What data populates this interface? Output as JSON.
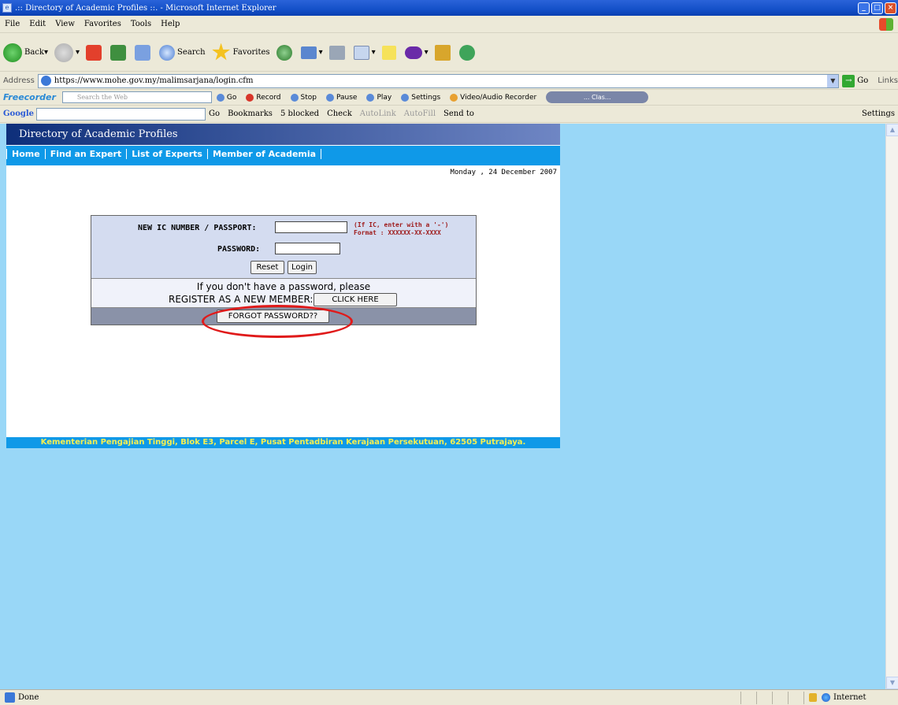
{
  "window": {
    "title": ".:: Directory of Academic Profiles ::. - Microsoft Internet Explorer"
  },
  "menu": [
    "File",
    "Edit",
    "View",
    "Favorites",
    "Tools",
    "Help"
  ],
  "toolbar": {
    "back": "Back",
    "search": "Search",
    "favorites": "Favorites"
  },
  "address": {
    "label": "Address",
    "url": "https://www.mohe.gov.my/malimsarjana/login.cfm",
    "go": "Go",
    "links": "Links"
  },
  "freecorder": {
    "brand": "Freecorder",
    "search_placeholder": "Search the Web",
    "go": "Go",
    "record": "Record",
    "stop": "Stop",
    "pause": "Pause",
    "play": "Play",
    "settings": "Settings",
    "recorder": "Video/Audio Recorder",
    "clas": "... Clas..."
  },
  "google": {
    "logo": "Google",
    "go": "Go",
    "bookmarks": "Bookmarks",
    "blocked": "5 blocked",
    "check": "Check",
    "autolink": "AutoLink",
    "autofill": "AutoFill",
    "sendto": "Send to",
    "settings": "Settings"
  },
  "site": {
    "title": "Directory of Academic Profiles",
    "nav": [
      "Home",
      "Find an Expert",
      "List of Experts",
      "Member of Academia"
    ],
    "date": "Monday , 24 December 2007"
  },
  "login": {
    "ic_label": "NEW IC NUMBER / PASSPORT:",
    "ic_hint1": "(If IC, enter with a '-')",
    "ic_hint2": "Format : XXXXXX-XX-XXXX",
    "password_label": "PASSWORD:",
    "reset": "Reset",
    "login": "Login",
    "register_line1": "If you don't have a password, please",
    "register_line2": "REGISTER AS A NEW MEMBER:",
    "click_here": "CLICK HERE",
    "forgot": "FORGOT PASSWORD??"
  },
  "footer": "Kementerian Pengajian Tinggi, Blok E3, Parcel E, Pusat Pentadbiran Kerajaan Persekutuan, 62505 Putrajaya.",
  "status": {
    "text": "Done",
    "zone": "Internet"
  },
  "colors": {
    "page_bg": "#99d7f7",
    "nav_blue": "#0f99e8",
    "highlight_circle": "#e01a1a"
  }
}
